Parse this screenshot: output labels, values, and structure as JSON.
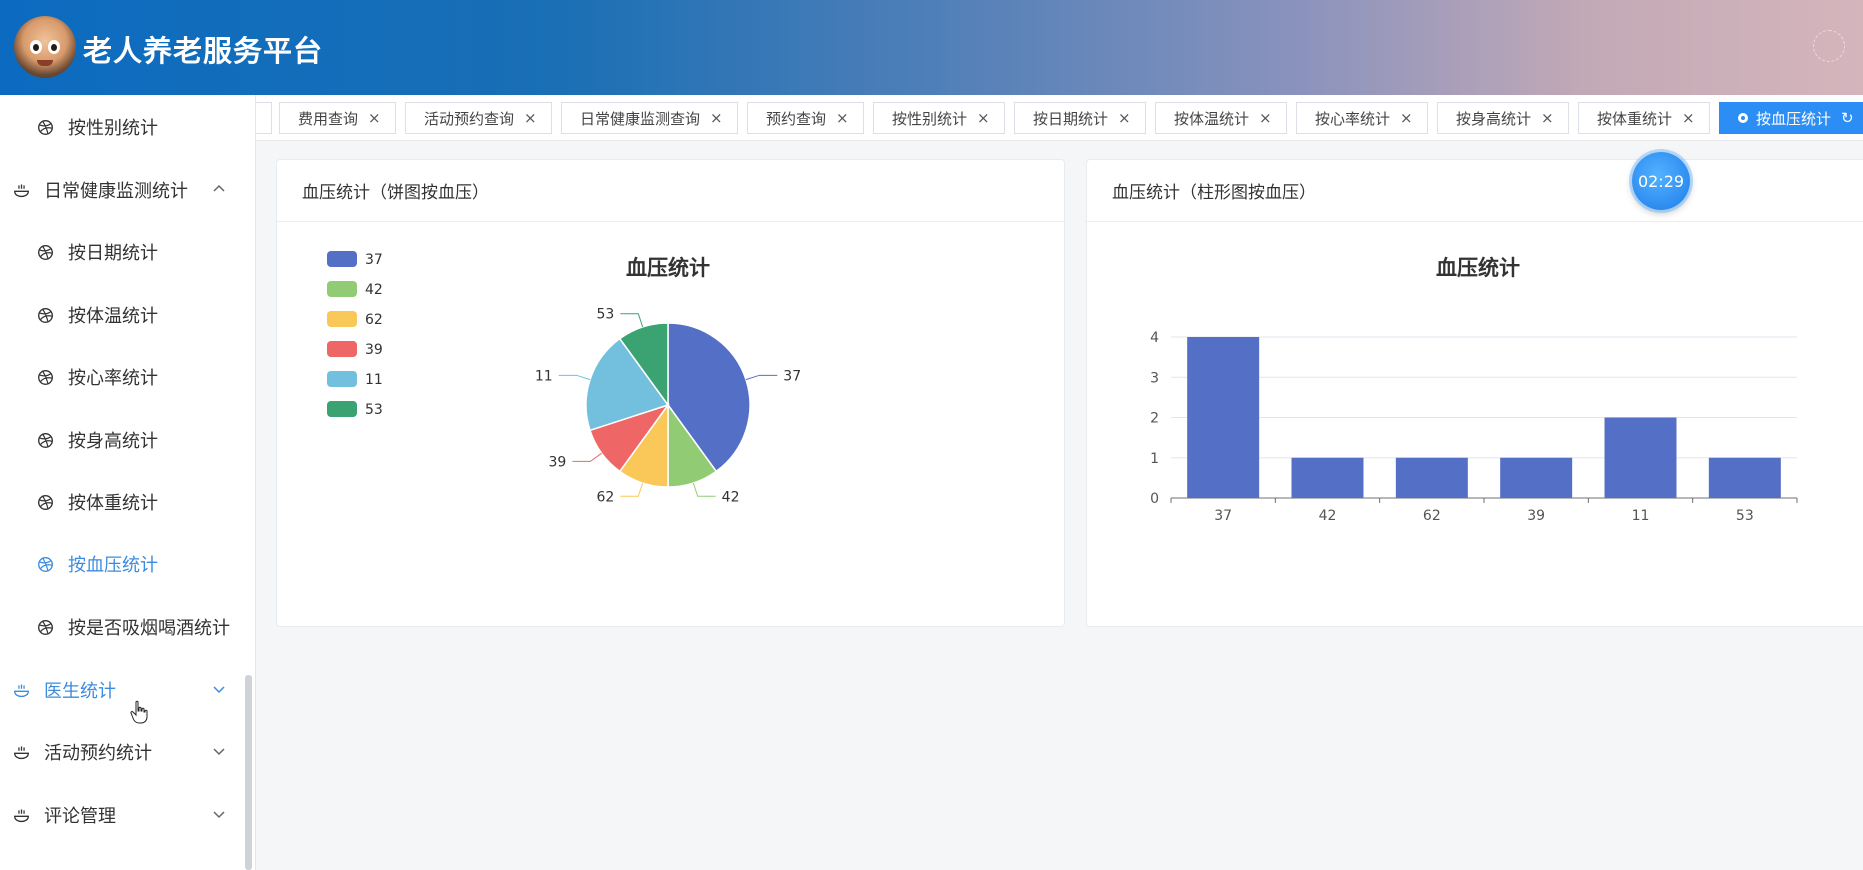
{
  "header": {
    "title": "老人养老服务平台"
  },
  "sidebar": {
    "items": [
      {
        "label": "按性别统计",
        "level": "sub",
        "icon": "dribbble-icon",
        "active": false
      },
      {
        "label": "日常健康监测统计",
        "level": "top",
        "icon": "bowl-icon",
        "expanded": true
      },
      {
        "label": "按日期统计",
        "level": "sub",
        "icon": "dribbble-icon",
        "active": false
      },
      {
        "label": "按体温统计",
        "level": "sub",
        "icon": "dribbble-icon",
        "active": false
      },
      {
        "label": "按心率统计",
        "level": "sub",
        "icon": "dribbble-icon",
        "active": false
      },
      {
        "label": "按身高统计",
        "level": "sub",
        "icon": "dribbble-icon",
        "active": false
      },
      {
        "label": "按体重统计",
        "level": "sub",
        "icon": "dribbble-icon",
        "active": false
      },
      {
        "label": "按血压统计",
        "level": "sub",
        "icon": "dribbble-icon",
        "active": true
      },
      {
        "label": "按是否吸烟喝酒统计",
        "level": "sub",
        "icon": "dribbble-icon",
        "active": false
      },
      {
        "label": "医生统计",
        "level": "top",
        "icon": "bowl-icon",
        "expanded": false,
        "active": true
      },
      {
        "label": "活动预约统计",
        "level": "top",
        "icon": "bowl-icon",
        "expanded": false
      },
      {
        "label": "评论管理",
        "level": "top",
        "icon": "bowl-icon",
        "expanded": false
      }
    ]
  },
  "tabs": [
    {
      "label": "费用查询",
      "active": false
    },
    {
      "label": "活动预约查询",
      "active": false
    },
    {
      "label": "日常健康监测查询",
      "active": false
    },
    {
      "label": "预约查询",
      "active": false
    },
    {
      "label": "按性别统计",
      "active": false
    },
    {
      "label": "按日期统计",
      "active": false
    },
    {
      "label": "按体温统计",
      "active": false
    },
    {
      "label": "按心率统计",
      "active": false
    },
    {
      "label": "按身高统计",
      "active": false
    },
    {
      "label": "按体重统计",
      "active": false
    },
    {
      "label": "按血压统计",
      "active": true
    }
  ],
  "timer": {
    "text": "02:29"
  },
  "pie_card": {
    "header": "血压统计（饼图按血压）"
  },
  "bar_card": {
    "header": "血压统计（柱形图按血压）"
  },
  "chart_data": [
    {
      "type": "pie",
      "title": "血压统计",
      "categories": [
        "37",
        "42",
        "62",
        "39",
        "11",
        "53"
      ],
      "values": [
        4,
        1,
        1,
        1,
        2,
        1
      ],
      "colors": [
        "#5470c6",
        "#91cc75",
        "#fac858",
        "#ee6666",
        "#73c0de",
        "#3ba272"
      ],
      "legend_position": "top-left"
    },
    {
      "type": "bar",
      "title": "血压统计",
      "categories": [
        "37",
        "42",
        "62",
        "39",
        "11",
        "53"
      ],
      "values": [
        4,
        1,
        1,
        1,
        2,
        1
      ],
      "ylim": [
        0,
        4
      ],
      "yticks": [
        0,
        1,
        2,
        3,
        4
      ],
      "color": "#5470c6",
      "grid": true
    }
  ]
}
